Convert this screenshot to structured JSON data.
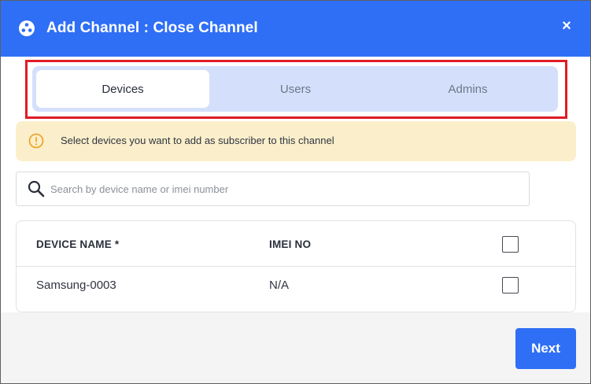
{
  "header": {
    "title": "Add Channel : Close Channel",
    "icon": "channel-icon",
    "close_label": "×"
  },
  "tabs": [
    {
      "label": "Devices",
      "active": true
    },
    {
      "label": "Users",
      "active": false
    },
    {
      "label": "Admins",
      "active": false
    }
  ],
  "info": {
    "icon": "info-icon",
    "text": "Select devices you want to add as subscriber to this channel"
  },
  "search": {
    "icon": "search-icon",
    "placeholder": "Search by device name or imei number",
    "value": ""
  },
  "table": {
    "columns": [
      "DEVICE NAME *",
      "IMEI NO"
    ],
    "rows": [
      {
        "device_name": "Samsung-0003",
        "imei": "N/A",
        "checked": false
      }
    ],
    "select_all_checked": false
  },
  "footer": {
    "next_label": "Next"
  },
  "colors": {
    "primary": "#2f6ff5",
    "highlight": "#e01c24",
    "info_bg": "#fbefcb",
    "tab_bg": "#d4e0fb"
  }
}
